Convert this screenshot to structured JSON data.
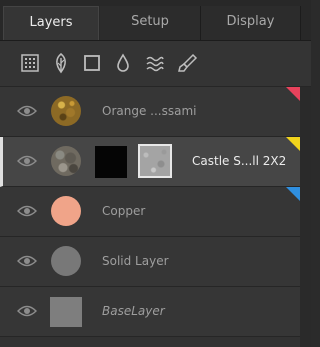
{
  "tabs": [
    {
      "label": "Layers",
      "active": true
    },
    {
      "label": "Setup",
      "active": false
    },
    {
      "label": "Display",
      "active": false
    }
  ],
  "toolbar": [
    {
      "icon": "grid-icon"
    },
    {
      "icon": "leaf-icon"
    },
    {
      "icon": "square-icon"
    },
    {
      "icon": "drop-icon"
    },
    {
      "icon": "waves-icon"
    },
    {
      "icon": "brush-icon"
    }
  ],
  "layers": [
    {
      "name": "Orange ...ssami",
      "thumb": "orange-texture",
      "selected": false,
      "tag_color": "#e8425c",
      "visible": true
    },
    {
      "name": "Castle S...ll 2X2",
      "thumb": "castle-stone",
      "selected": true,
      "tag_color": "#f2d41c",
      "has_mask": true,
      "has_texture": true,
      "visible": true
    },
    {
      "name": "Copper",
      "thumb": "copper-color",
      "selected": false,
      "tag_color": "#2f8fe0",
      "swatch": "#f0a489",
      "visible": true
    },
    {
      "name": "Solid Layer",
      "thumb": "solid-gray",
      "selected": false,
      "swatch": "#787878",
      "visible": true
    },
    {
      "name": "BaseLayer",
      "thumb": "base-gray",
      "selected": false,
      "swatch": "#7e7e7e",
      "italic": true,
      "visible": true
    }
  ]
}
